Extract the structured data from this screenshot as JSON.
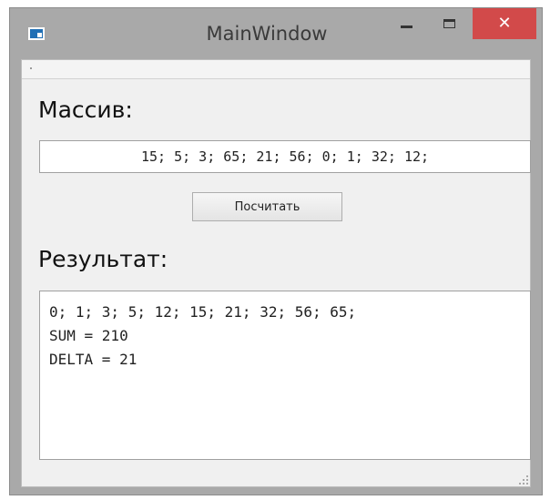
{
  "window": {
    "title": "MainWindow",
    "close_glyph": "✕"
  },
  "array_section": {
    "heading": "Массив:",
    "input_value": "15; 5; 3; 65; 21; 56; 0; 1; 32; 12;"
  },
  "button": {
    "label": "Посчитать"
  },
  "result_section": {
    "heading": "Результат:",
    "lines": [
      "0; 1; 3; 5; 12; 15; 21; 32; 56; 65;",
      "SUM = 210",
      "DELTA = 21"
    ]
  },
  "icons": {
    "app": "window-app-icon",
    "minimize": "minimize-icon",
    "maximize": "maximize-icon",
    "close": "close-icon",
    "grip": "resize-grip-icon"
  },
  "colors": {
    "close_button": "#d24a4a",
    "frame": "#a9a9a9",
    "client_background": "#f0f0f0"
  }
}
